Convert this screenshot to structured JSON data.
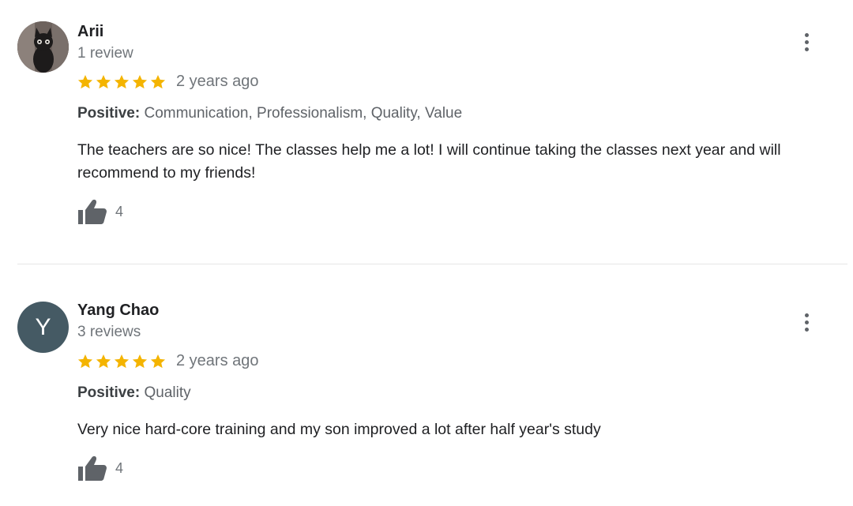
{
  "colors": {
    "star": "#f4b400",
    "thumb": "#5f6368",
    "avatar_bg": "#455a64",
    "divider": "#e6e6e6"
  },
  "reviews": [
    {
      "author": "Arii",
      "review_count": "1 review",
      "avatar": {
        "type": "photo",
        "icon": "cat-photo"
      },
      "rating": 5,
      "date": "2 years ago",
      "attributes_label": "Positive:",
      "attributes_value": "Communication, Professionalism, Quality, Value",
      "text": "The teachers are so nice! The classes help me a lot! I will continue taking the classes next year and will recommend to my friends!",
      "likes": "4"
    },
    {
      "author": "Yang Chao",
      "review_count": "3 reviews",
      "avatar": {
        "type": "letter",
        "letter": "Y"
      },
      "rating": 5,
      "date": "2 years ago",
      "attributes_label": "Positive:",
      "attributes_value": "Quality",
      "text": "Very nice hard-core training and my son improved a lot after half year's study",
      "likes": "4"
    }
  ]
}
